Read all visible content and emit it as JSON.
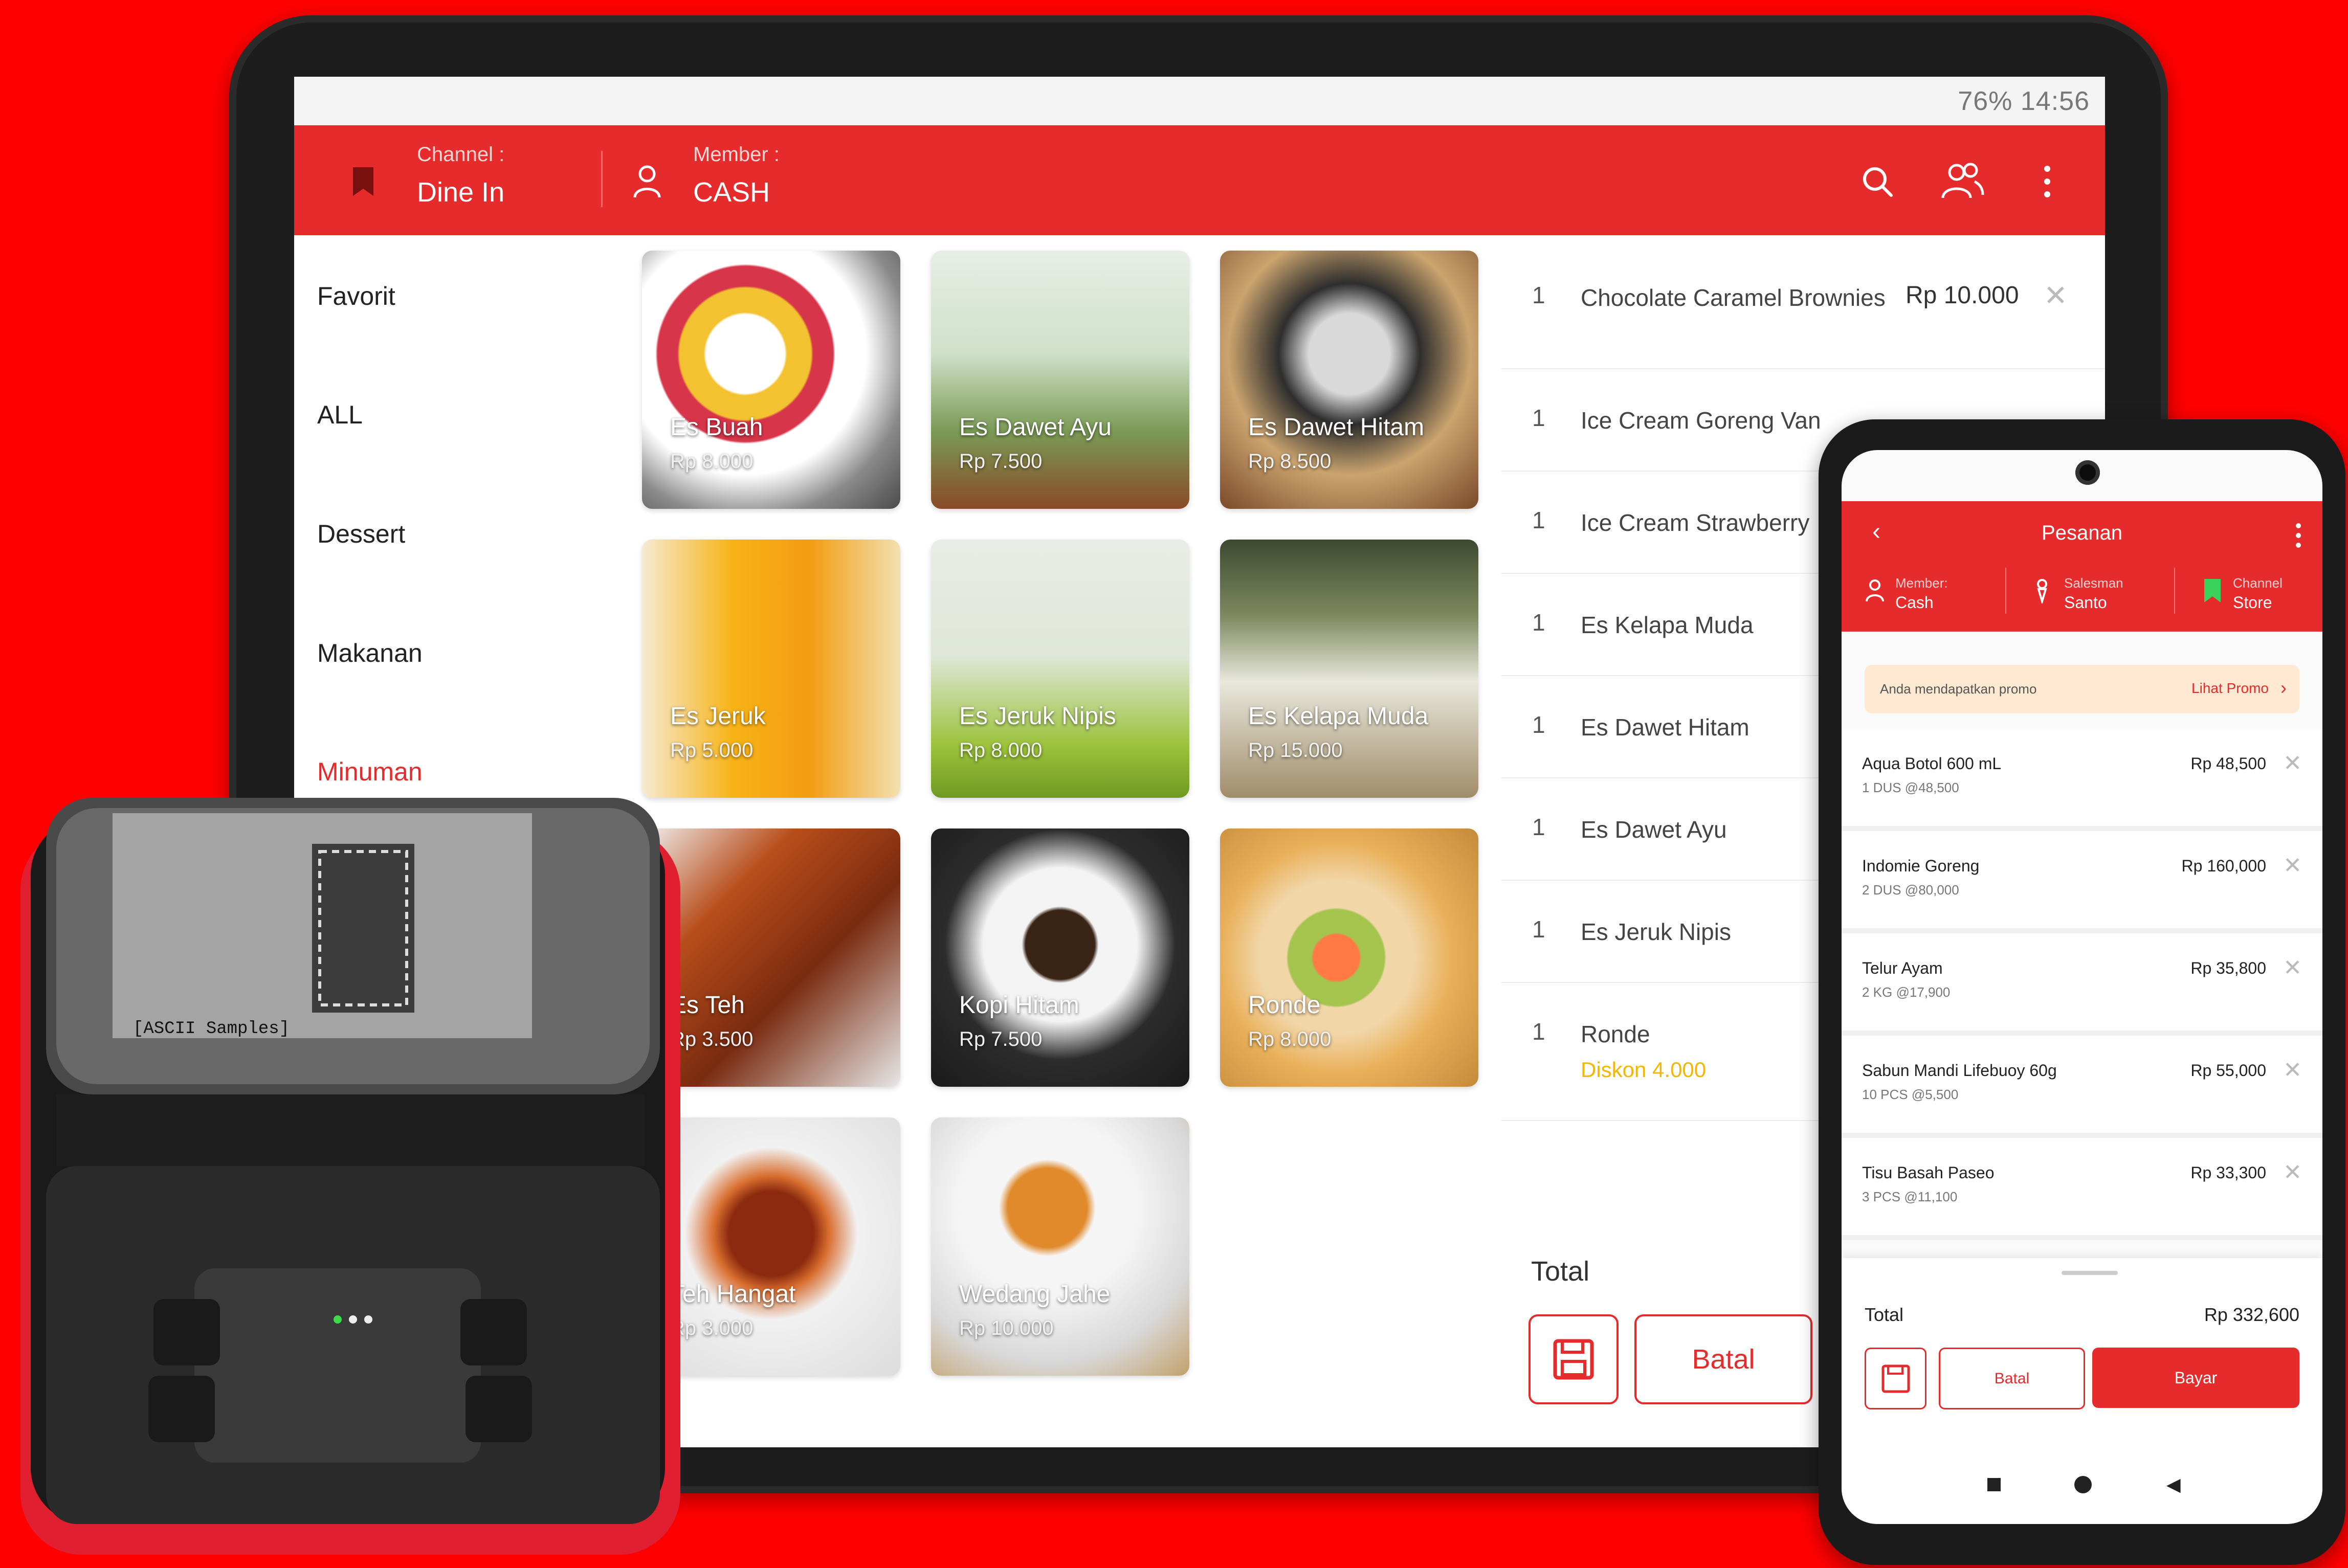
{
  "colors": {
    "brand_red": "#e52b2b",
    "discount": "#f2b705",
    "background": "#ff0000"
  },
  "tablet": {
    "status_bar": "76% 14:56",
    "header": {
      "channel_label": "Channel :",
      "channel_value": "Dine In",
      "member_label": "Member :",
      "member_value": "CASH",
      "icons": [
        "bookmark-icon",
        "user-icon",
        "search-icon",
        "users-icon",
        "more-vertical-icon"
      ]
    },
    "categories": [
      {
        "label": "Favorit",
        "active": false
      },
      {
        "label": "ALL",
        "active": false
      },
      {
        "label": "Dessert",
        "active": false
      },
      {
        "label": "Makanan",
        "active": false
      },
      {
        "label": "Minuman",
        "active": true
      }
    ],
    "products": [
      {
        "name": "Es Buah",
        "price": "Rp 8.000"
      },
      {
        "name": "Es Dawet Ayu",
        "price": "Rp 7.500"
      },
      {
        "name": "Es Dawet Hitam",
        "price": "Rp 8.500"
      },
      {
        "name": "Es Jeruk",
        "price": "Rp 5.000"
      },
      {
        "name": "Es Jeruk Nipis",
        "price": "Rp 8.000"
      },
      {
        "name": "Es Kelapa Muda",
        "price": "Rp 15.000"
      },
      {
        "name": "Es Teh",
        "price": "Rp 3.500"
      },
      {
        "name": "Kopi Hitam",
        "price": "Rp 7.500"
      },
      {
        "name": "Ronde",
        "price": "Rp 8.000"
      },
      {
        "name": "Teh Hangat",
        "price": "Rp 3.000"
      },
      {
        "name": "Wedang Jahe",
        "price": "Rp 10.000"
      }
    ],
    "order": {
      "items": [
        {
          "qty": "1",
          "name": "Chocolate Caramel Brownies",
          "price": "Rp 10.000",
          "discount": ""
        },
        {
          "qty": "1",
          "name": "Ice Cream Goreng Van",
          "price": "",
          "discount": ""
        },
        {
          "qty": "1",
          "name": "Ice Cream Strawberry",
          "price": "",
          "discount": ""
        },
        {
          "qty": "1",
          "name": "Es Kelapa Muda",
          "price": "",
          "discount": ""
        },
        {
          "qty": "1",
          "name": "Es Dawet Hitam",
          "price": "",
          "discount": ""
        },
        {
          "qty": "1",
          "name": "Es Dawet Ayu",
          "price": "",
          "discount": ""
        },
        {
          "qty": "1",
          "name": "Es Jeruk Nipis",
          "price": "",
          "discount": ""
        },
        {
          "qty": "1",
          "name": "Ronde",
          "price": "",
          "discount": "Diskon 4.000"
        }
      ],
      "total_label": "Total",
      "cancel_label": "Batal"
    }
  },
  "phone": {
    "title": "Pesanan",
    "member_label": "Member:",
    "member_value": "Cash",
    "salesman_label": "Salesman",
    "salesman_value": "Santo",
    "channel_label": "Channel",
    "channel_value": "Store",
    "promo_text": "Anda mendapatkan promo",
    "promo_link": "Lihat Promo",
    "items": [
      {
        "name": "Aqua Botol 600 mL",
        "sub": "1 DUS @48,500",
        "price": "Rp 48,500"
      },
      {
        "name": "Indomie Goreng",
        "sub": "2 DUS @80,000",
        "price": "Rp 160,000"
      },
      {
        "name": "Telur Ayam",
        "sub": "2 KG @17,900",
        "price": "Rp 35,800"
      },
      {
        "name": "Sabun Mandi Lifebuoy 60g",
        "sub": "10 PCS @5,500",
        "price": "Rp 55,000"
      },
      {
        "name": "Tisu Basah Paseo",
        "sub": "3 PCS @11,100",
        "price": "Rp 33,300"
      }
    ],
    "total_label": "Total",
    "total_value": "Rp 332,600",
    "cancel_label": "Batal",
    "pay_label": "Bayar"
  },
  "printer": {
    "receipt_text": "[ASCII Samples]"
  }
}
